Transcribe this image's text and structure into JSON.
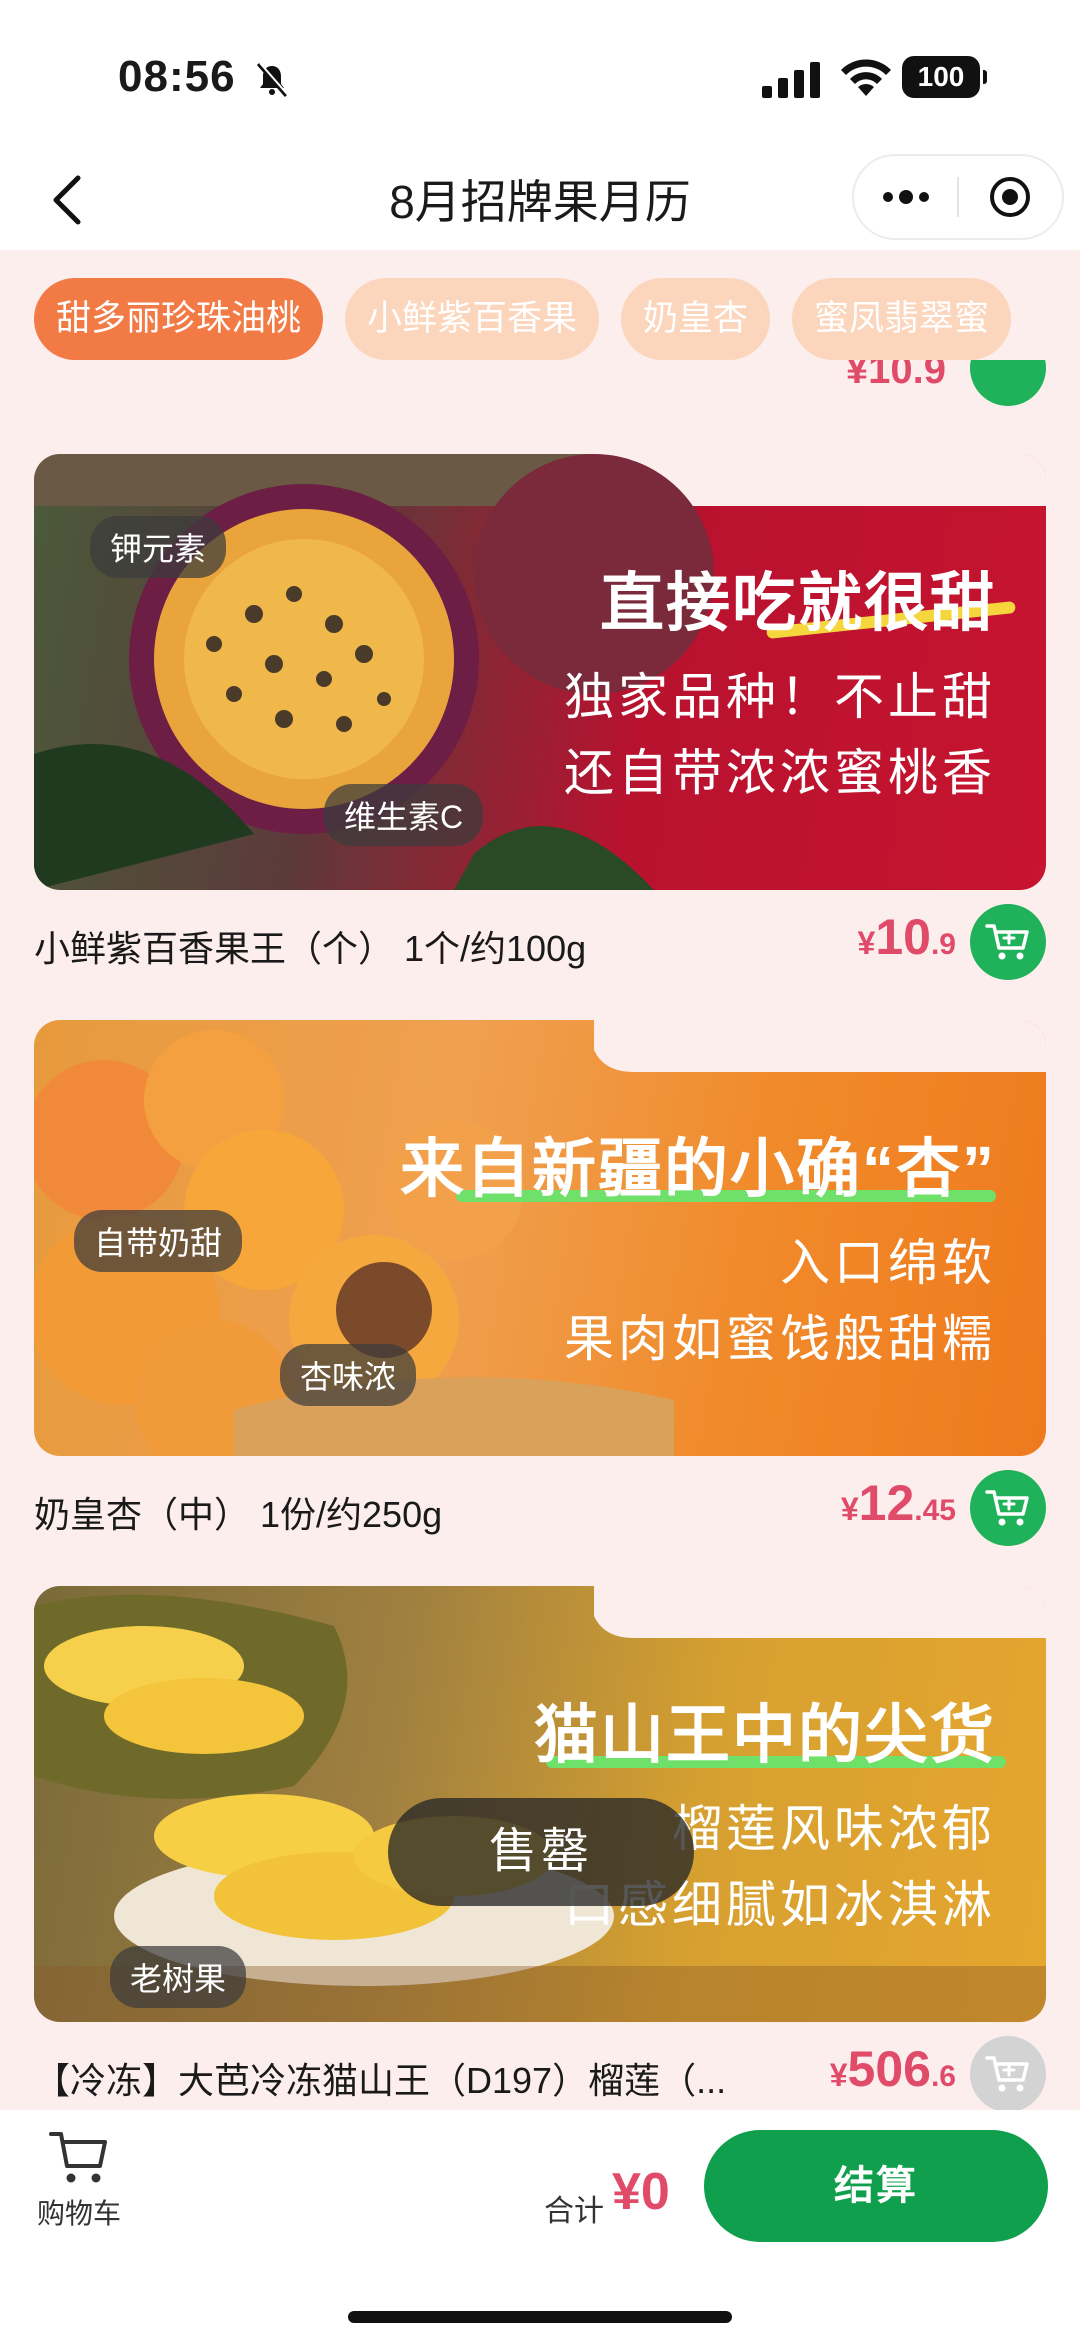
{
  "status": {
    "time": "08:56",
    "battery": "100"
  },
  "nav": {
    "title": "8月招牌果月历"
  },
  "tabs": [
    "甜多丽珍珠油桃",
    "小鲜紫百香果",
    "奶皇杏",
    "蜜凤翡翠蜜"
  ],
  "peek": {
    "price": "¥10.9"
  },
  "products": [
    {
      "tags": [
        "钾元素",
        "维生素C"
      ],
      "headline": "直接吃就很甜",
      "sublines": [
        "独家品种！不止甜",
        "还自带浓浓蜜桃香"
      ],
      "name": "小鲜紫百香果王（个） 1个/约100g",
      "price": {
        "currency": "¥",
        "integer": "10",
        "decimal": ".9"
      },
      "available": true
    },
    {
      "tags": [
        "自带奶甜",
        "杏味浓"
      ],
      "headline": "来自新疆的小确“杏”",
      "sublines": [
        "入口绵软",
        "果肉如蜜饯般甜糯"
      ],
      "name": "奶皇杏（中） 1份/约250g",
      "price": {
        "currency": "¥",
        "integer": "12",
        "decimal": ".45"
      },
      "available": true
    },
    {
      "tags": [
        "老树果"
      ],
      "headline": "猫山王中的尖货",
      "sublines": [
        "榴莲风味浓郁",
        "口感细腻如冰淇淋"
      ],
      "name": "【冷冻】大芭冷冻猫山王（D197）榴莲（...",
      "price": {
        "currency": "¥",
        "integer": "506",
        "decimal": ".6"
      },
      "available": false,
      "overlay": "售罄"
    }
  ],
  "bottom": {
    "cart_label": "购物车",
    "total_label": "合计",
    "total_value": "¥0",
    "checkout_label": "结算"
  },
  "colors": {
    "accent": "#f27a45",
    "price": "#e14b6a",
    "cart_green": "#1fb25a",
    "checkout_green": "#0f9f4d"
  }
}
